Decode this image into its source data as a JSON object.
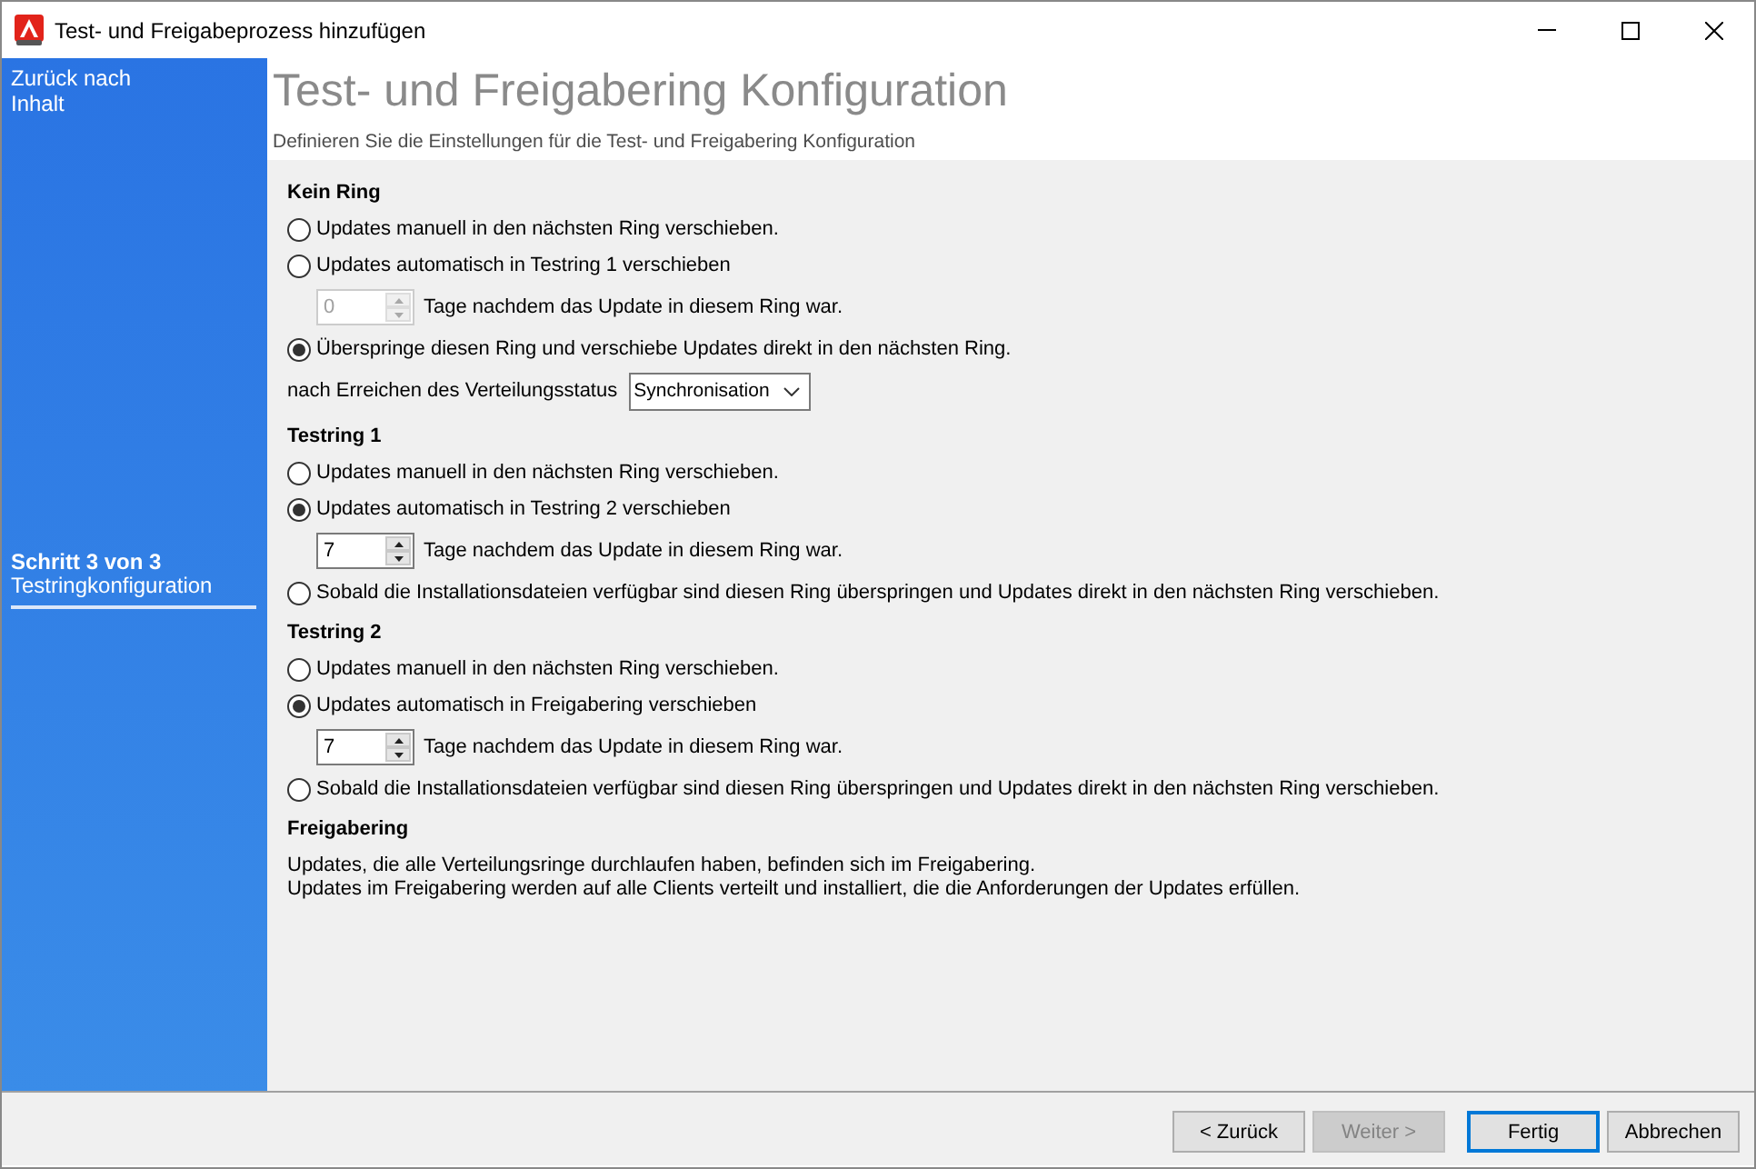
{
  "window": {
    "title": "Test- und Freigabeprozess hinzufügen"
  },
  "sidebar": {
    "back_link": "Zurück nach Inhalt",
    "step": {
      "counter": "Schritt 3 von 3",
      "name": "Testringkonfiguration"
    }
  },
  "header": {
    "title": "Test- und Freigabering Konfiguration",
    "subtitle": "Definieren Sie die Einstellungen für die Test- und Freigabering Konfiguration"
  },
  "sections": [
    {
      "title": "Kein Ring",
      "items": [
        {
          "kind": "radio",
          "label": "Updates manuell in den nächsten Ring verschieben.",
          "selected": false
        },
        {
          "kind": "radio",
          "label": "Updates automatisch in Testring 1 verschieben",
          "selected": false,
          "delay": {
            "value": "0",
            "disabled": true,
            "suffix": "Tage nachdem das Update in diesem Ring war."
          }
        },
        {
          "kind": "radio",
          "label": "Überspringe diesen Ring und verschiebe Updates direkt in den nächsten Ring.",
          "selected": true
        },
        {
          "kind": "dropdown",
          "label": "nach Erreichen des Verteilungsstatus",
          "value": "Synchronisation"
        }
      ]
    },
    {
      "title": "Testring 1",
      "items": [
        {
          "kind": "radio",
          "label": "Updates manuell in den nächsten Ring verschieben.",
          "selected": false
        },
        {
          "kind": "radio",
          "label": "Updates automatisch in Testring 2 verschieben",
          "selected": true,
          "delay": {
            "value": "7",
            "disabled": false,
            "suffix": "Tage nachdem das Update in diesem Ring war."
          }
        },
        {
          "kind": "radio",
          "label": "Sobald die Installationsdateien verfügbar sind diesen Ring überspringen und Updates direkt in den nächsten Ring verschieben.",
          "selected": false
        }
      ]
    },
    {
      "title": "Testring 2",
      "items": [
        {
          "kind": "radio",
          "label": "Updates manuell in den nächsten Ring verschieben.",
          "selected": false
        },
        {
          "kind": "radio",
          "label": "Updates automatisch in Freigabering verschieben",
          "selected": true,
          "delay": {
            "value": "7",
            "disabled": false,
            "suffix": "Tage nachdem das Update in diesem Ring war."
          }
        },
        {
          "kind": "radio",
          "label": "Sobald die Installationsdateien verfügbar sind diesen Ring überspringen und Updates direkt in den nächsten Ring verschieben.",
          "selected": false
        }
      ]
    },
    {
      "title": "Freigabering",
      "items": [
        {
          "kind": "text",
          "label": "Updates, die alle Verteilungsringe durchlaufen haben, befinden sich im Freigabering."
        },
        {
          "kind": "text",
          "label": "Updates im Freigabering werden auf alle Clients verteilt und installiert, die die Anforderungen der Updates erfüllen."
        }
      ]
    }
  ],
  "buttons": [
    {
      "label": "< Zurück",
      "disabled": false,
      "default": false
    },
    {
      "label": "Weiter >",
      "disabled": true,
      "default": false
    },
    {
      "label": "Fertig",
      "disabled": false,
      "default": true
    },
    {
      "label": "Abbrechen",
      "disabled": false,
      "default": false
    }
  ]
}
